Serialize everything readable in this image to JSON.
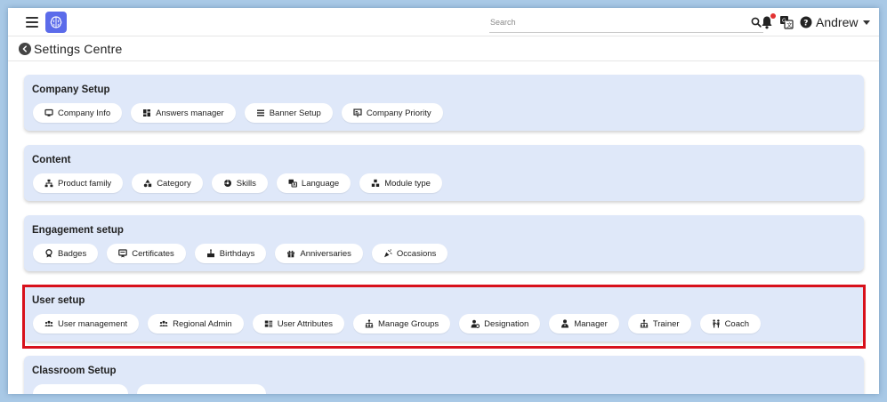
{
  "header": {
    "search_placeholder": "Search",
    "user_name": "Andrew"
  },
  "page": {
    "title": "Settings Centre"
  },
  "sections": [
    {
      "title": "Company Setup",
      "chips": [
        {
          "label": "Company Info",
          "icon": "monitor-icon"
        },
        {
          "label": "Answers manager",
          "icon": "dashboard-icon"
        },
        {
          "label": "Banner Setup",
          "icon": "list-icon"
        },
        {
          "label": "Company Priority",
          "icon": "presentation-icon"
        }
      ]
    },
    {
      "title": "Content",
      "chips": [
        {
          "label": "Product family",
          "icon": "sitemap-icon"
        },
        {
          "label": "Category",
          "icon": "shapes-icon"
        },
        {
          "label": "Skills",
          "icon": "puzzle-icon"
        },
        {
          "label": "Language",
          "icon": "translate-icon"
        },
        {
          "label": "Module type",
          "icon": "cubes-icon"
        }
      ]
    },
    {
      "title": "Engagement setup",
      "chips": [
        {
          "label": "Badges",
          "icon": "badge-icon"
        },
        {
          "label": "Certificates",
          "icon": "certificate-icon"
        },
        {
          "label": "Birthdays",
          "icon": "cake-icon"
        },
        {
          "label": "Anniversaries",
          "icon": "gift-icon"
        },
        {
          "label": "Occasions",
          "icon": "party-icon"
        }
      ]
    },
    {
      "title": "User setup",
      "chips": [
        {
          "label": "User management",
          "icon": "users-icon"
        },
        {
          "label": "Regional Admin",
          "icon": "users-icon"
        },
        {
          "label": "User Attributes",
          "icon": "attributes-icon"
        },
        {
          "label": "Manage Groups",
          "icon": "hierarchy-icon"
        },
        {
          "label": "Designation",
          "icon": "user-gear-icon"
        },
        {
          "label": "Manager",
          "icon": "user-tie-icon"
        },
        {
          "label": "Trainer",
          "icon": "hierarchy-icon"
        },
        {
          "label": "Coach",
          "icon": "people-icon"
        }
      ]
    },
    {
      "title": "Classroom Setup",
      "chips": []
    }
  ],
  "colors": {
    "accent": "#5b6bea",
    "section_bg": "#dfe8f9",
    "highlight": "#d8111b",
    "notification": "#e23232"
  }
}
